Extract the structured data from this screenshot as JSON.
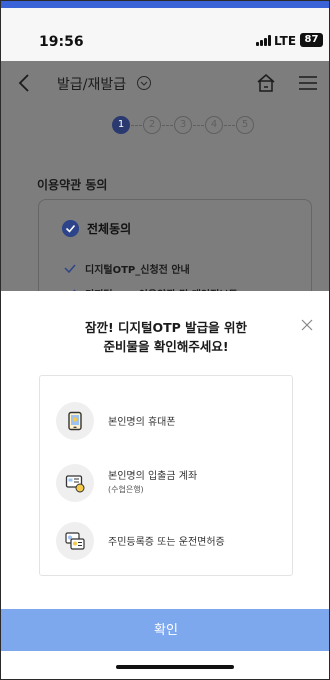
{
  "status_bar": {
    "time": "19:56",
    "network": "LTE",
    "battery": "87"
  },
  "header": {
    "title": "발급/재발급"
  },
  "steps": [
    "1",
    "2",
    "3",
    "4",
    "5"
  ],
  "terms": {
    "section_title": "이용약관 동의",
    "all_agree": "전체동의",
    "items": [
      "디지털OTP_신청전 안내",
      "디지털OTP 이용약관 및 개인정보동"
    ]
  },
  "modal": {
    "title_line1": "잠깐! 디지털OTP 발급을 위한",
    "title_line2": "준비물을 확인해주세요!",
    "requirements": [
      {
        "icon": "phone-icon",
        "label": "본인명의 휴대폰"
      },
      {
        "icon": "bank-account-icon",
        "label": "본인명의 입출금 계좌",
        "sub": "(수협은행)"
      },
      {
        "icon": "id-card-icon",
        "label": "주민등록증 또는 운전면허증"
      }
    ],
    "confirm": "확인"
  },
  "colors": {
    "accent": "#7ea8ee",
    "dim": "#7d7d7d",
    "check": "#2d448a",
    "top_bar": "#3b63d8"
  }
}
